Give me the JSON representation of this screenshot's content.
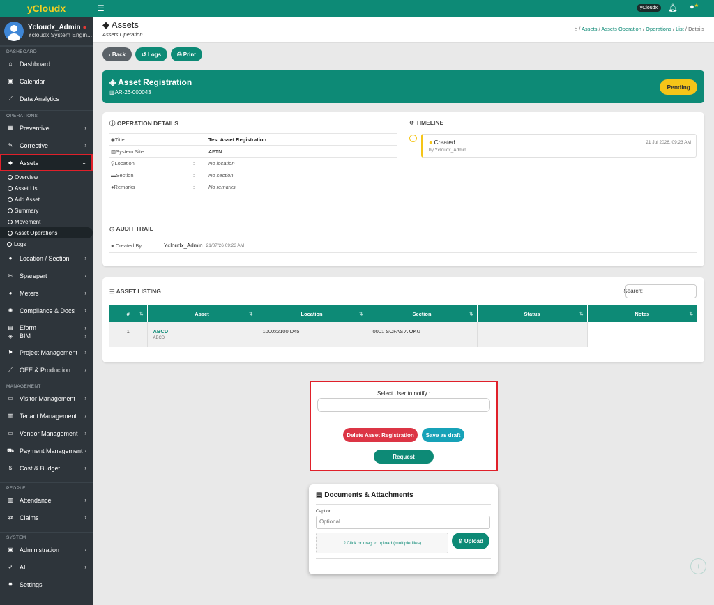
{
  "app": {
    "brand": "yCloudx",
    "user_name": "Ycloudx_Admin",
    "user_role": "Ycloudx System Engin...",
    "user_chip": "yCloudx"
  },
  "sidebar": {
    "dashboard_section": "DASHBOARD",
    "dashboard_items": [
      {
        "label": "Dashboard",
        "icon": "home-icon"
      },
      {
        "label": "Calendar",
        "icon": "calendar-icon"
      },
      {
        "label": "Data Analytics",
        "icon": "chart-line-icon"
      }
    ],
    "operations_section": "OPERATIONS",
    "operations_items": [
      {
        "label": "Preventive",
        "icon": "calendar-grid-icon"
      },
      {
        "label": "Corrective",
        "icon": "wrench-icon"
      },
      {
        "label": "Assets",
        "icon": "tag-icon"
      }
    ],
    "assets_sub": [
      "Overview",
      "Asset List",
      "Add Asset",
      "Summary",
      "Movement",
      "Asset Operations"
    ],
    "logs": "Logs",
    "operations_items_2": [
      {
        "label": "Location / Section",
        "icon": "globe-icon"
      },
      {
        "label": "Sparepart",
        "icon": "tools-icon"
      },
      {
        "label": "Meters",
        "icon": "gauge-icon"
      },
      {
        "label": "Compliance & Docs",
        "icon": "certificate-icon"
      },
      {
        "label": "Eform",
        "icon": "form-icon"
      },
      {
        "label": "BIM",
        "icon": "cube-icon"
      },
      {
        "label": "Project Management",
        "icon": "flag-icon"
      },
      {
        "label": "OEE & Production",
        "icon": "chart-line-icon"
      }
    ],
    "management_section": "MANAGEMENT",
    "management_items": [
      {
        "label": "Visitor Management",
        "icon": "id-card-icon"
      },
      {
        "label": "Tenant Management",
        "icon": "building-icon"
      },
      {
        "label": "Vendor Management",
        "icon": "address-card-icon"
      },
      {
        "label": "Payment Management",
        "icon": "cart-icon"
      },
      {
        "label": "Cost & Budget",
        "icon": "dollar-icon"
      }
    ],
    "people_section": "PEOPLE",
    "people_items": [
      {
        "label": "Attendance",
        "icon": "building-icon"
      },
      {
        "label": "Claims",
        "icon": "exchange-icon"
      }
    ],
    "system_section": "SYSTEM",
    "system_items": [
      {
        "label": "Administration",
        "icon": "user-badge-icon"
      },
      {
        "label": "AI",
        "icon": "rocket-icon"
      },
      {
        "label": "Settings",
        "icon": "gear-icon"
      }
    ]
  },
  "header": {
    "title": "Assets",
    "subtitle": "Assets Operation",
    "breadcrumb": [
      "Assets",
      "Assets Operation",
      "Operations",
      "List",
      "Details"
    ]
  },
  "actions": {
    "back": "Back",
    "logs": "Logs",
    "print": "Print"
  },
  "registration": {
    "title": "Asset Registration",
    "code": "AR-26-000043",
    "status": "Pending",
    "status_color": "#f5c518"
  },
  "details": {
    "title": "OPERATION DETAILS",
    "rows": [
      {
        "label": "Title",
        "value": "Test Asset Registration"
      },
      {
        "label": "System Site",
        "value": "AFTN"
      },
      {
        "label": "Location",
        "value": "No location"
      },
      {
        "label": "Section",
        "value": "No section"
      },
      {
        "label": "Remarks",
        "value": "No remarks"
      }
    ],
    "colon": ":"
  },
  "timeline": {
    "title": "TIMELINE",
    "event": "Created",
    "by": "by Ycloudx_Admin",
    "date": "21 Jul 2026, 09:23 AM"
  },
  "audit": {
    "title": "AUDIT TRAIL",
    "label": "Created By",
    "colon": ":",
    "user": "Ycloudx_Admin",
    "date": "21/07/26 09:23 AM"
  },
  "listing": {
    "title": "ASSET LISTING",
    "search_label": "Search:",
    "columns": [
      "#",
      "Asset",
      "Location",
      "Section",
      "Status",
      "Notes"
    ],
    "rows": [
      {
        "num": "1",
        "asset": "ABCD",
        "asset_sub": "ABCD",
        "location": "1000x2100 D45",
        "section": "0001 SOFAS A OKU",
        "status": "",
        "notes": ""
      }
    ]
  },
  "notify": {
    "label": "Select User to notify :",
    "delete": "Delete Asset Registration",
    "draft": "Save as draft",
    "request": "Request"
  },
  "documents": {
    "title": "Documents & Attachments",
    "caption_label": "Caption",
    "caption_placeholder": "Optional",
    "drop_text": "Click or drag to upload (multiple files)",
    "upload": "Upload"
  },
  "colors": {
    "primary": "#0d8a76",
    "danger": "#dc3545",
    "info": "#17a2b8",
    "warning": "#f5c518",
    "sidebar": "#2e353b"
  }
}
